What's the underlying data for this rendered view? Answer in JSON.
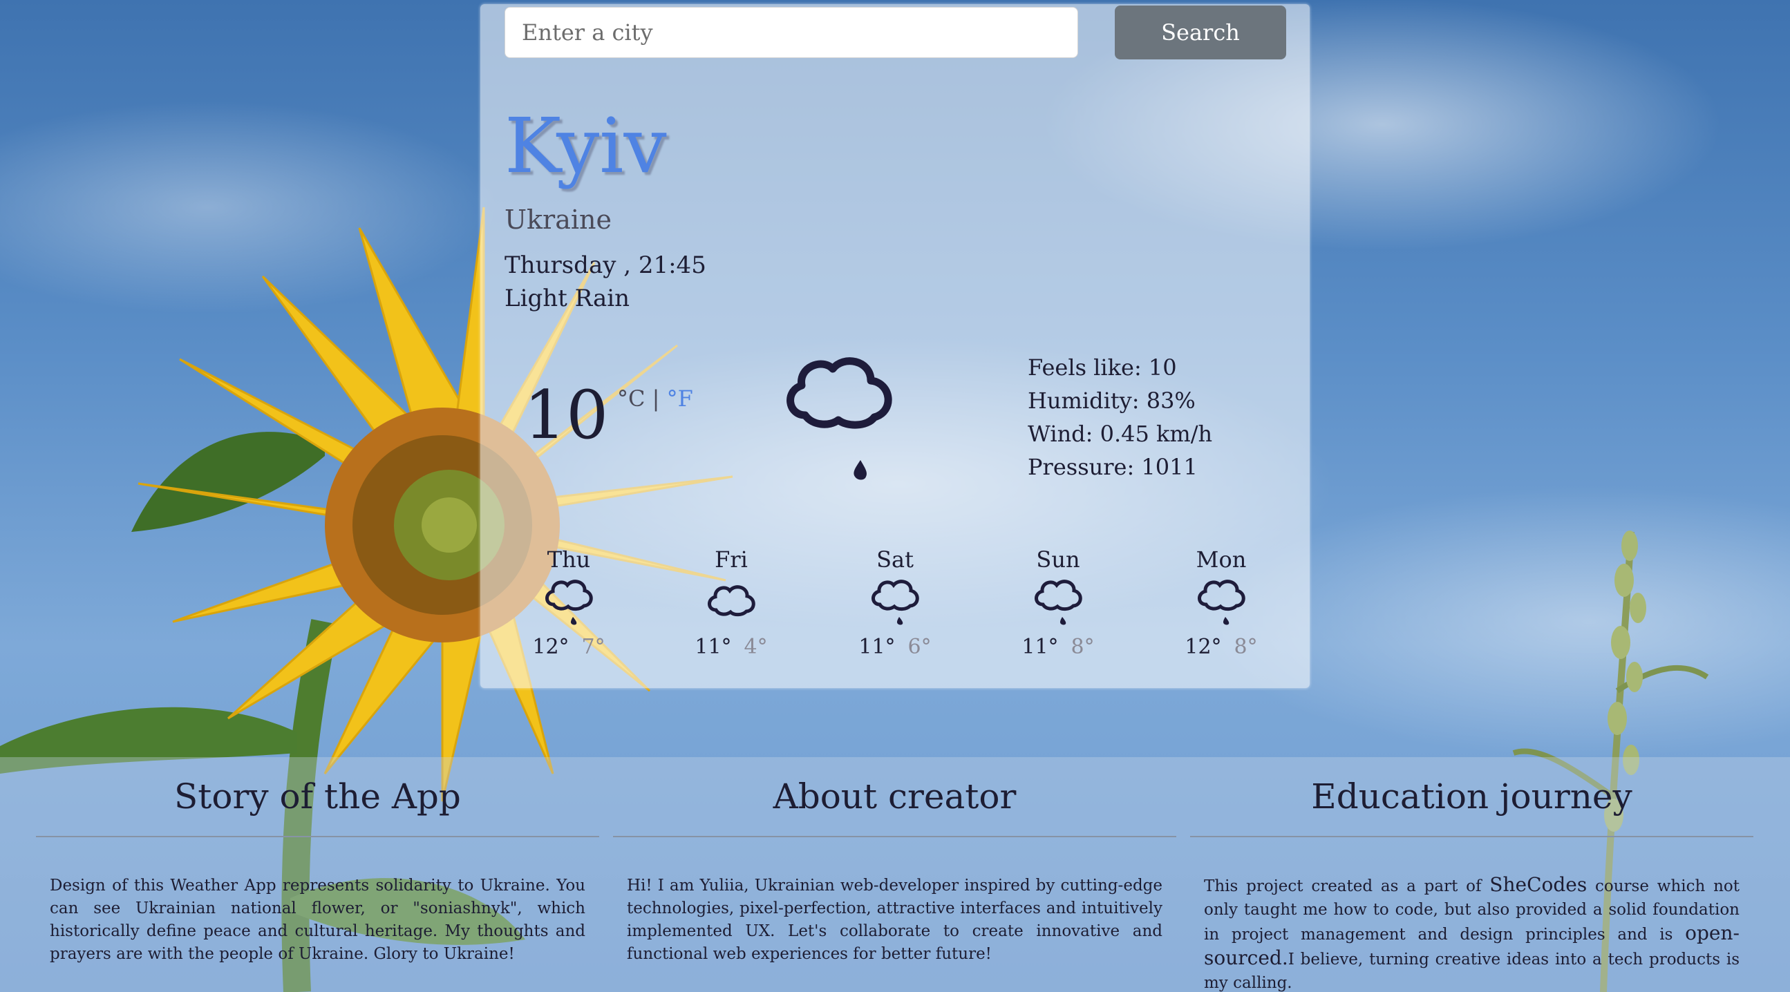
{
  "search": {
    "placeholder": "Enter a city",
    "value": "",
    "button_label": "Search"
  },
  "current": {
    "city": "Kyiv",
    "country": "Ukraine",
    "datetime": "Thursday , 21:45",
    "description": "Light Rain",
    "temperature": "10",
    "unit_celsius": "°C",
    "unit_separator": "|",
    "unit_fahrenheit": "°F",
    "icon": "light-rain-icon",
    "feels_like": "Feels like: 10",
    "humidity": "Humidity: 83%",
    "wind": "Wind: 0.45 km/h",
    "pressure": "Pressure: 1011"
  },
  "forecast": [
    {
      "day": "Thu",
      "max": "12°",
      "min": "7°",
      "icon": "rain-icon"
    },
    {
      "day": "Fri",
      "max": "11°",
      "min": "4°",
      "icon": "cloud-icon"
    },
    {
      "day": "Sat",
      "max": "11°",
      "min": "6°",
      "icon": "rain-icon"
    },
    {
      "day": "Sun",
      "max": "11°",
      "min": "8°",
      "icon": "rain-icon"
    },
    {
      "day": "Mon",
      "max": "12°",
      "min": "8°",
      "icon": "rain-icon"
    }
  ],
  "footer": {
    "story": {
      "title": "Story of the App",
      "text": "Design of this Weather App represents solidarity to Ukraine. You can see Ukrainian national flower, or \"soniashnyk\", which historically define peace and cultural heritage. My thoughts and prayers are with the people of Ukraine. Glory to Ukraine!"
    },
    "about": {
      "title": "About creator",
      "text": "Hi! I am Yuliia, Ukrainian web-developer inspired by cutting-edge technologies, pixel-perfection, attractive interfaces and intuitively implemented UX. Let's collaborate to create innovative and functional web experiences for better future!"
    },
    "education": {
      "title": "Education journey",
      "text_1": "This project created as a part of ",
      "link_shecodes": "SheCodes",
      "text_2": " course which not only taught me how to code, but also provided a solid foundation in project management and design principles and is ",
      "link_opensourced": "open-sourced.",
      "text_3": "I believe, turning creative ideas into a tech products is my calling."
    }
  },
  "colors": {
    "accent": "#4f83e3",
    "button": "#6c757d",
    "text_dark": "#1d1d33"
  }
}
